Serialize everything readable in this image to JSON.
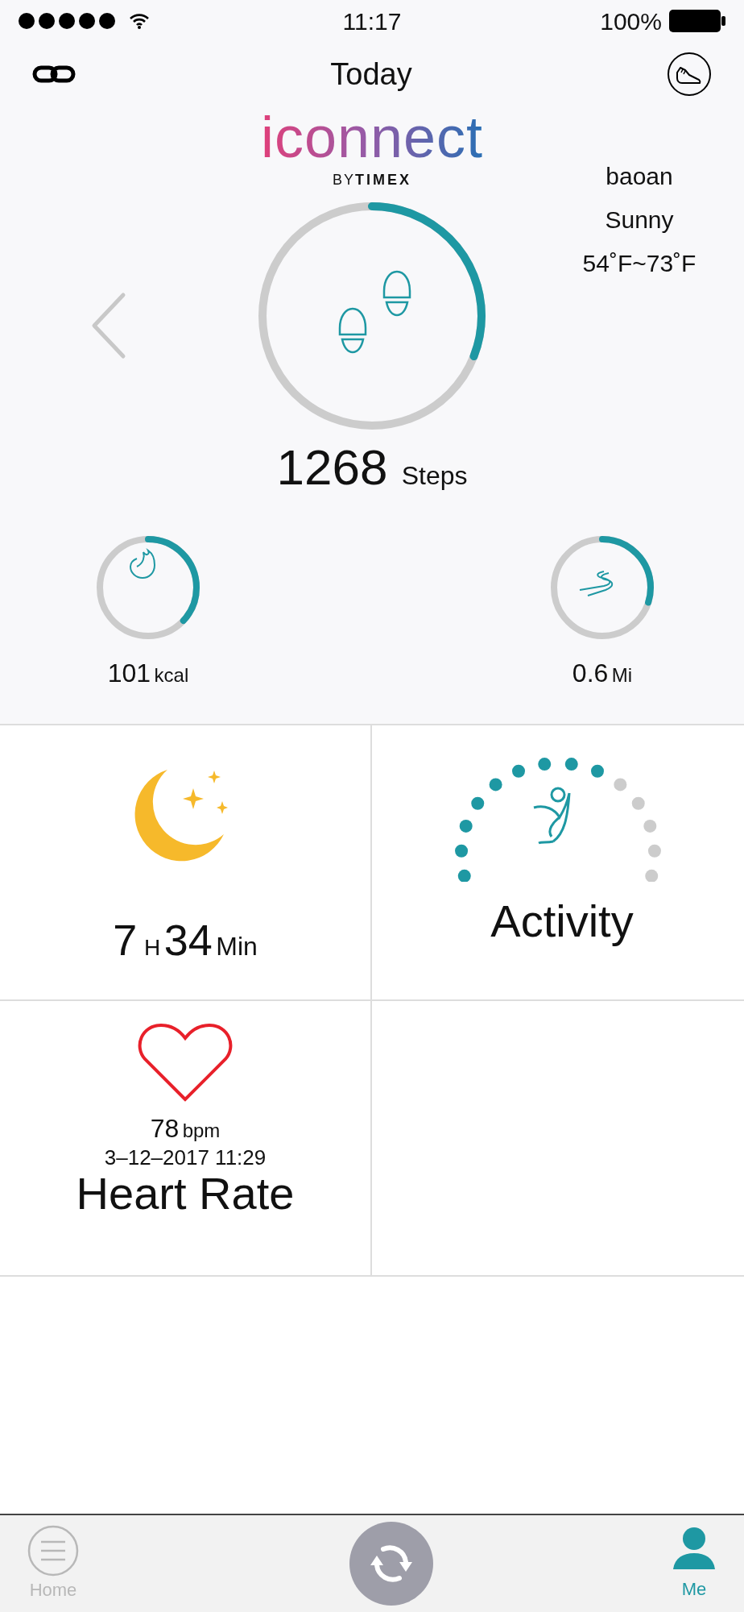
{
  "status_bar": {
    "time": "11:17",
    "battery": "100%"
  },
  "header": {
    "title": "Today"
  },
  "logo": {
    "wordmark": "iconnect",
    "by": "BY",
    "brand": "TIMEX"
  },
  "weather": {
    "location": "baoan",
    "condition": "Sunny",
    "temperature": "54˚F~73˚F"
  },
  "steps": {
    "value": "1268",
    "unit": "Steps",
    "level": 0.31
  },
  "metrics": [
    {
      "kind": "calories",
      "value": "101",
      "unit": "kcal",
      "level": 0.37
    },
    {
      "kind": "distance",
      "value": "0.6",
      "unit": "Mi",
      "level": 0.3
    }
  ],
  "tiles": [
    {
      "kind": "sleep",
      "hours": "7",
      "hours_unit": "H",
      "minutes": "34",
      "minutes_unit": "Min"
    },
    {
      "kind": "activity",
      "title": "Activity"
    },
    {
      "kind": "heart",
      "reading": "78",
      "unit": "bpm",
      "timestamp": "3–12–2017 11:29",
      "title": "Heart Rate"
    }
  ],
  "tab_bar": [
    {
      "kind": "home",
      "label": "Home",
      "selected": false
    },
    {
      "kind": "sync"
    },
    {
      "kind": "me",
      "label": "Me",
      "selected": true
    }
  ]
}
